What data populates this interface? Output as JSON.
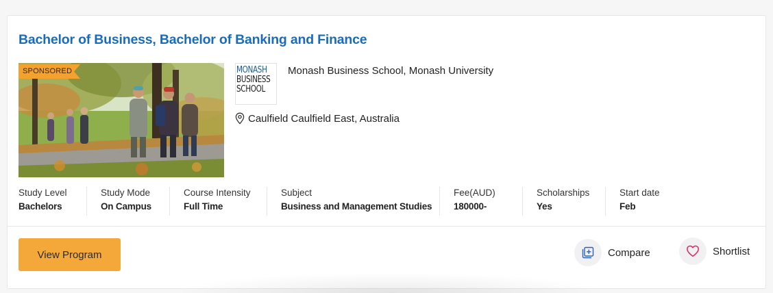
{
  "program": {
    "title": "Bachelor of Business, Bachelor of Banking and Finance",
    "badge": "SPONSORED",
    "photo_icon": "campus-students-photo"
  },
  "institution": {
    "logo_lines": [
      "MONASH",
      "BUSINESS",
      "SCHOOL"
    ],
    "name": "Monash Business School, Monash University",
    "location": "Caulfield Caulfield East, Australia",
    "location_icon": "map-pin-icon"
  },
  "facts": [
    {
      "label": "Study Level",
      "value": "Bachelors"
    },
    {
      "label": "Study Mode",
      "value": "On Campus"
    },
    {
      "label": "Course Intensity",
      "value": "Full Time"
    },
    {
      "label": "Subject",
      "value": "Business and Management Studies"
    },
    {
      "label": "Fee(AUD)",
      "value": "180000-"
    },
    {
      "label": "Scholarships",
      "value": "Yes"
    },
    {
      "label": "Start date",
      "value": "Feb"
    }
  ],
  "actions": {
    "view_program": "View Program",
    "compare": "Compare",
    "compare_icon": "compare-plus-icon",
    "shortlist": "Shortlist",
    "shortlist_icon": "heart-icon"
  },
  "colors": {
    "title": "#1a6bb8",
    "badge": "#f4a12e",
    "button": "#f5a83a",
    "heart": "#e0245e",
    "compare_icon": "#2a63b3"
  }
}
